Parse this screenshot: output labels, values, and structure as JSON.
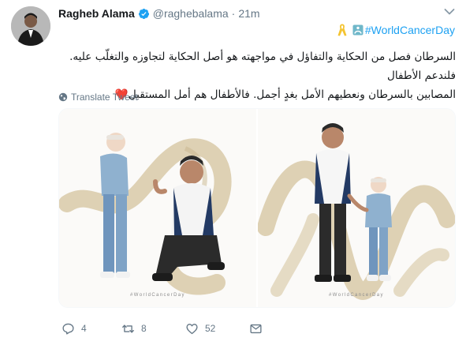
{
  "tweet": {
    "display_name": "Ragheb Alama",
    "handle": "@raghebalama",
    "separator": "·",
    "time": "21m",
    "hashtag": "#WorldCancerDay",
    "text_line1": "السرطان فصل من الحكاية والتفاؤل في مواجهته هو أصل الحكاية لتجاوزه والتغلّب عليه. فلندعم الأطفال",
    "text_line2": "المصابين بالسرطان ونعطيهم الأمل بغدٍ أجمل. فالأطفال هم أمل المستقبل",
    "heart_emoji": "❤️",
    "translate_label": "Translate Tweet"
  },
  "media": {
    "photos": [
      {
        "caption": "#WorldCancerDay"
      },
      {
        "caption": "#WorldCancerDay"
      }
    ]
  },
  "actions": {
    "reply_count": "4",
    "retweet_count": "8",
    "like_count": "52"
  },
  "colors": {
    "link": "#1da1f2",
    "muted": "#657786",
    "verified": "#1da1f2",
    "ribbon_gold": "#d8c9a8",
    "cancer_ribbon": "#f4c431"
  }
}
